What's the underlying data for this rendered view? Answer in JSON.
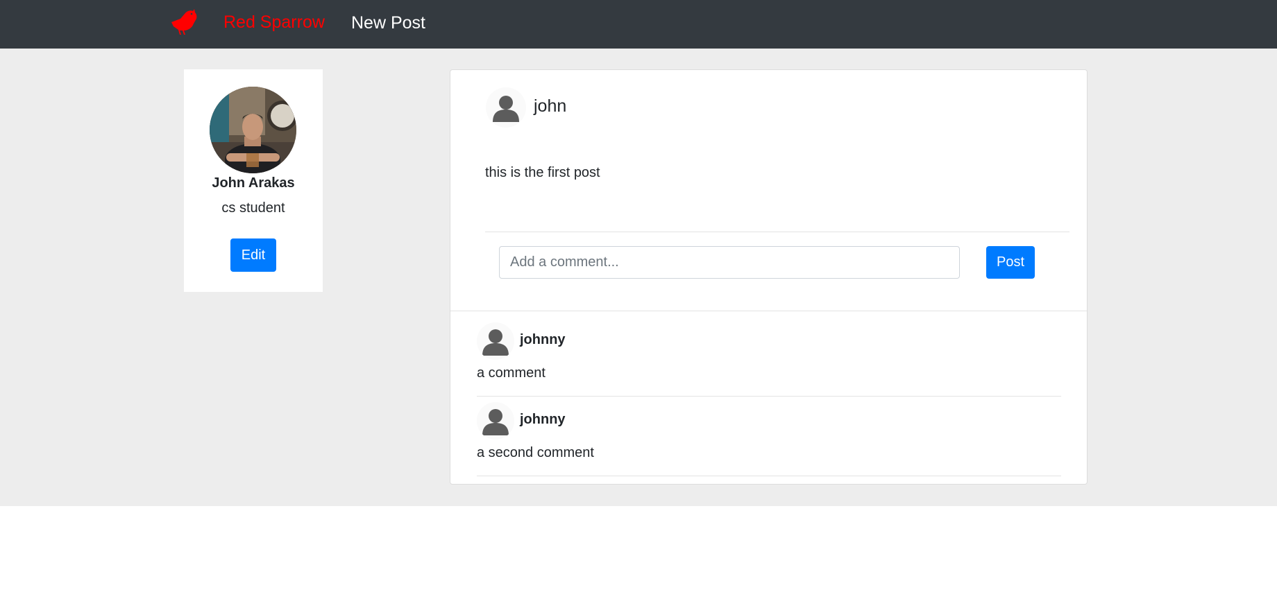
{
  "navbar": {
    "brand": "Red Sparrow",
    "new_post": "New Post"
  },
  "profile": {
    "name": "John Arakas",
    "bio": "cs student",
    "edit_label": "Edit"
  },
  "post": {
    "author": "john",
    "text": "this is the first post",
    "comment_placeholder": "Add a comment...",
    "post_button": "Post"
  },
  "comments": [
    {
      "author": "johnny",
      "text": "a comment"
    },
    {
      "author": "johnny",
      "text": "a second comment"
    }
  ],
  "colors": {
    "navbar": "#343a40",
    "brand": "#ff0000",
    "primary": "#007bff",
    "page_bg": "#ededed"
  },
  "icons": {
    "brand_logo": "sparrow-icon",
    "avatar_placeholder": "user-silhouette-icon"
  }
}
